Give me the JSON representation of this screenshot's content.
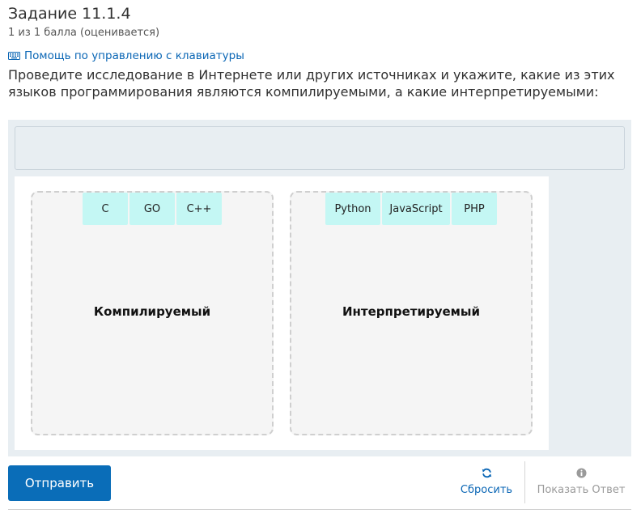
{
  "problem": {
    "title": "Задание 11.1.4",
    "score": "1 из 1 балла (оценивается)",
    "keyboard_help": "Помощь по управлению с клавиатуры",
    "prompt": "Проведите исследование в Интернете или других источниках и укажите, какие из этих языков программирования являются компилируемыми, а какие интерпретируемыми:"
  },
  "zones": [
    {
      "label": "Компилируемый",
      "items": [
        "C",
        "GO",
        "C++"
      ]
    },
    {
      "label": "Интерпретируемый",
      "items": [
        "Python",
        "JavaScript",
        "PHP"
      ]
    }
  ],
  "actions": {
    "submit": "Отправить",
    "reset": "Сбросить",
    "show_answer": "Показать Ответ"
  },
  "colors": {
    "accent": "#0a6db8",
    "link": "#0a66b5",
    "item_bg": "#c4f7f4",
    "workspace_bg": "#e8eef2",
    "zone_bg": "#f5f5f5",
    "disabled": "#9a9a9a"
  },
  "icons": {
    "keyboard_help": "keyboard-icon",
    "reset": "refresh-icon",
    "show_answer": "info-icon"
  }
}
